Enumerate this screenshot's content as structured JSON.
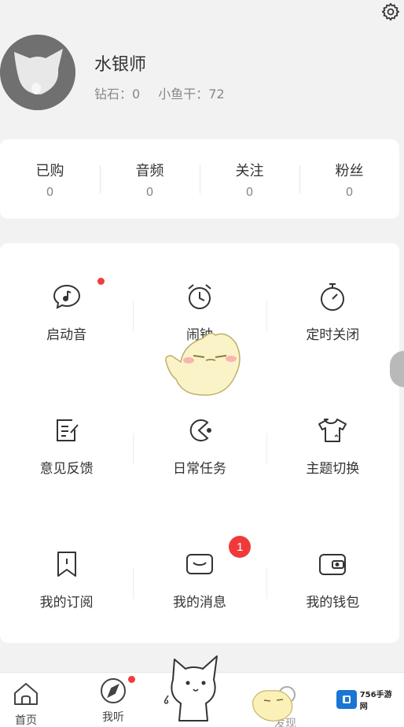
{
  "profile": {
    "username": "水银师",
    "diamonds": "钻石：0",
    "fish": "小鱼干：72"
  },
  "counts": [
    {
      "label": "已购",
      "value": "0"
    },
    {
      "label": "音频",
      "value": "0"
    },
    {
      "label": "关注",
      "value": "0"
    },
    {
      "label": "粉丝",
      "value": "0"
    }
  ],
  "grid": [
    {
      "label": "启动音",
      "icon": "music-bubble-icon",
      "dot": true
    },
    {
      "label": "闹钟",
      "icon": "alarm-clock-icon"
    },
    {
      "label": "定时关闭",
      "icon": "timer-icon"
    },
    {
      "label": "意见反馈",
      "icon": "feedback-icon"
    },
    {
      "label": "日常任务",
      "icon": "pacman-icon"
    },
    {
      "label": "主题切换",
      "icon": "tshirt-icon"
    },
    {
      "label": "我的订阅",
      "icon": "bookmark-icon"
    },
    {
      "label": "我的消息",
      "icon": "message-icon",
      "badge": "1"
    },
    {
      "label": "我的钱包",
      "icon": "wallet-icon"
    }
  ],
  "nav": {
    "home": "首页",
    "listen": "我听",
    "discover": "发现"
  },
  "watermark": {
    "text": "756手游网"
  },
  "colors": {
    "accent_red": "#f23c3c",
    "background": "#f2f2f2",
    "card": "#ffffff"
  }
}
